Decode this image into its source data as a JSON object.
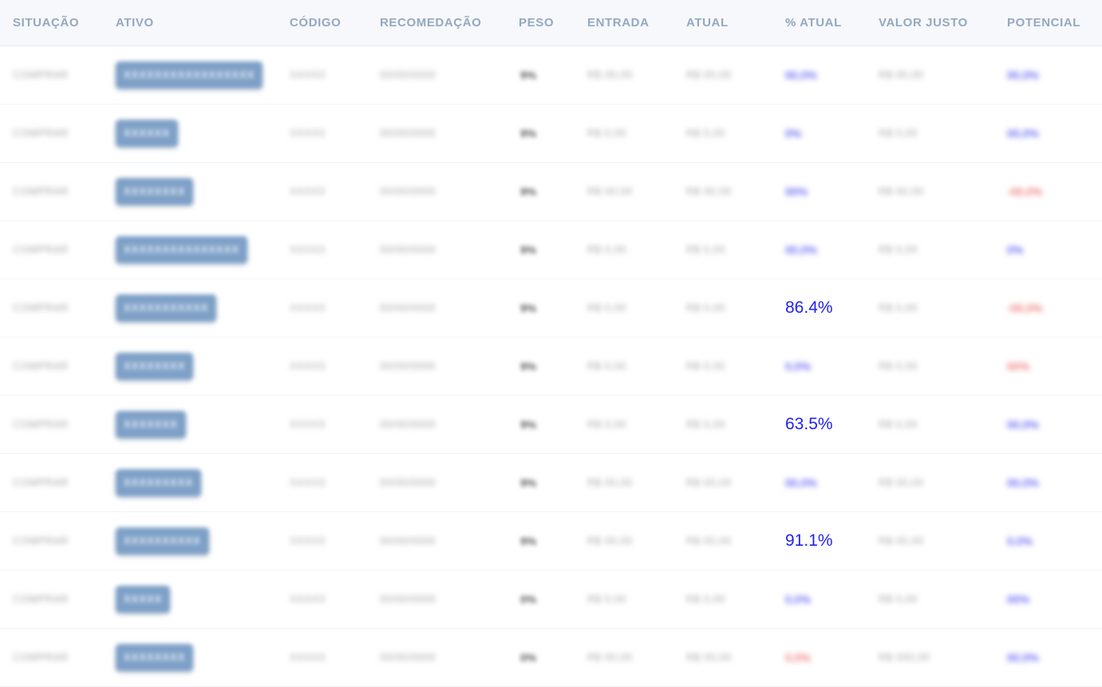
{
  "colors": {
    "positive": "#2222ee",
    "negative": "#e64040",
    "badge": "#7ea0c7",
    "header": "#94a8c0"
  },
  "headers": [
    "SITUAÇÃO",
    "ATIVO",
    "CÓDIGO",
    "RECOMEDAÇÃO",
    "PESO",
    "ENTRADA",
    "ATUAL",
    "% ATUAL",
    "VALOR JUSTO",
    "POTENCIAL"
  ],
  "rows": [
    {
      "situacao": "COMPRAR",
      "ativo": "XXXXXXXXXXXXXXXXX",
      "codigo": "XXXX3",
      "recomendacao": "00/00/0000",
      "peso": "9%",
      "entrada": "R$ 00,00",
      "atual": "R$ 00,00",
      "pct": "00,0%",
      "pct_visible": false,
      "pct_neg": false,
      "valor_justo": "R$ 00,00",
      "potencial": "00,0%",
      "pot_neg": false
    },
    {
      "situacao": "COMPRAR",
      "ativo": "XXXXXX",
      "codigo": "XXXX3",
      "recomendacao": "00/00/0000",
      "peso": "9%",
      "entrada": "R$ 0,00",
      "atual": "R$ 0,00",
      "pct": "0%",
      "pct_visible": false,
      "pct_neg": false,
      "valor_justo": "R$ 0,00",
      "potencial": "00,0%",
      "pot_neg": false
    },
    {
      "situacao": "COMPRAR",
      "ativo": "XXXXXXXX",
      "codigo": "XXXX3",
      "recomendacao": "00/00/0000",
      "peso": "9%",
      "entrada": "R$ 00,00",
      "atual": "R$ 00,00",
      "pct": "00%",
      "pct_visible": false,
      "pct_neg": false,
      "valor_justo": "R$ 00,00",
      "potencial": "-00,0%",
      "pot_neg": true
    },
    {
      "situacao": "COMPRAR",
      "ativo": "XXXXXXXXXXXXXXX",
      "codigo": "XXXX3",
      "recomendacao": "00/00/0000",
      "peso": "9%",
      "entrada": "R$ 0,00",
      "atual": "R$ 0,00",
      "pct": "00,0%",
      "pct_visible": false,
      "pct_neg": false,
      "valor_justo": "R$ 0,00",
      "potencial": "0%",
      "pot_neg": false
    },
    {
      "situacao": "COMPRAR",
      "ativo": "XXXXXXXXXXX",
      "codigo": "XXXX3",
      "recomendacao": "00/00/0000",
      "peso": "9%",
      "entrada": "R$ 0,00",
      "atual": "R$ 0,00",
      "pct": "86.4%",
      "pct_visible": true,
      "pct_neg": false,
      "valor_justo": "R$ 0,00",
      "potencial": "-00,0%",
      "pot_neg": true
    },
    {
      "situacao": "COMPRAR",
      "ativo": "XXXXXXXX",
      "codigo": "XXXX3",
      "recomendacao": "00/00/0000",
      "peso": "9%",
      "entrada": "R$ 0,00",
      "atual": "R$ 0,00",
      "pct": "0,0%",
      "pct_visible": false,
      "pct_neg": false,
      "valor_justo": "R$ 0,00",
      "potencial": "00%",
      "pot_neg": true
    },
    {
      "situacao": "COMPRAR",
      "ativo": "XXXXXXX",
      "codigo": "XXXX3",
      "recomendacao": "00/00/0000",
      "peso": "9%",
      "entrada": "R$ 0,00",
      "atual": "R$ 0,00",
      "pct": "63.5%",
      "pct_visible": true,
      "pct_neg": false,
      "valor_justo": "R$ 0,00",
      "potencial": "00,0%",
      "pot_neg": false
    },
    {
      "situacao": "COMPRAR",
      "ativo": "XXXXXXXXX",
      "codigo": "XXXX3",
      "recomendacao": "00/00/0000",
      "peso": "9%",
      "entrada": "R$ 00,00",
      "atual": "R$ 00,00",
      "pct": "00,0%",
      "pct_visible": false,
      "pct_neg": false,
      "valor_justo": "R$ 00,00",
      "potencial": "00,0%",
      "pot_neg": false
    },
    {
      "situacao": "COMPRAR",
      "ativo": "XXXXXXXXXX",
      "codigo": "XXXX3",
      "recomendacao": "00/00/0000",
      "peso": "9%",
      "entrada": "R$ 00,00",
      "atual": "R$ 00,00",
      "pct": "91.1%",
      "pct_visible": true,
      "pct_neg": false,
      "valor_justo": "R$ 00,00",
      "potencial": "0,0%",
      "pot_neg": false
    },
    {
      "situacao": "COMPRAR",
      "ativo": "XXXXX",
      "codigo": "XXXX3",
      "recomendacao": "00/00/0000",
      "peso": "0%",
      "entrada": "R$ 0,00",
      "atual": "R$ 0,00",
      "pct": "0,0%",
      "pct_visible": false,
      "pct_neg": false,
      "valor_justo": "R$ 0,00",
      "potencial": "00%",
      "pot_neg": false
    },
    {
      "situacao": "COMPRAR",
      "ativo": "XXXXXXXX",
      "codigo": "XXXX3",
      "recomendacao": "00/00/0000",
      "peso": "0%",
      "entrada": "R$ 00,00",
      "atual": "R$ 00,00",
      "pct": "0,0%",
      "pct_visible": false,
      "pct_neg": true,
      "valor_justo": "R$ 000,00",
      "potencial": "00,0%",
      "pot_neg": false
    }
  ]
}
